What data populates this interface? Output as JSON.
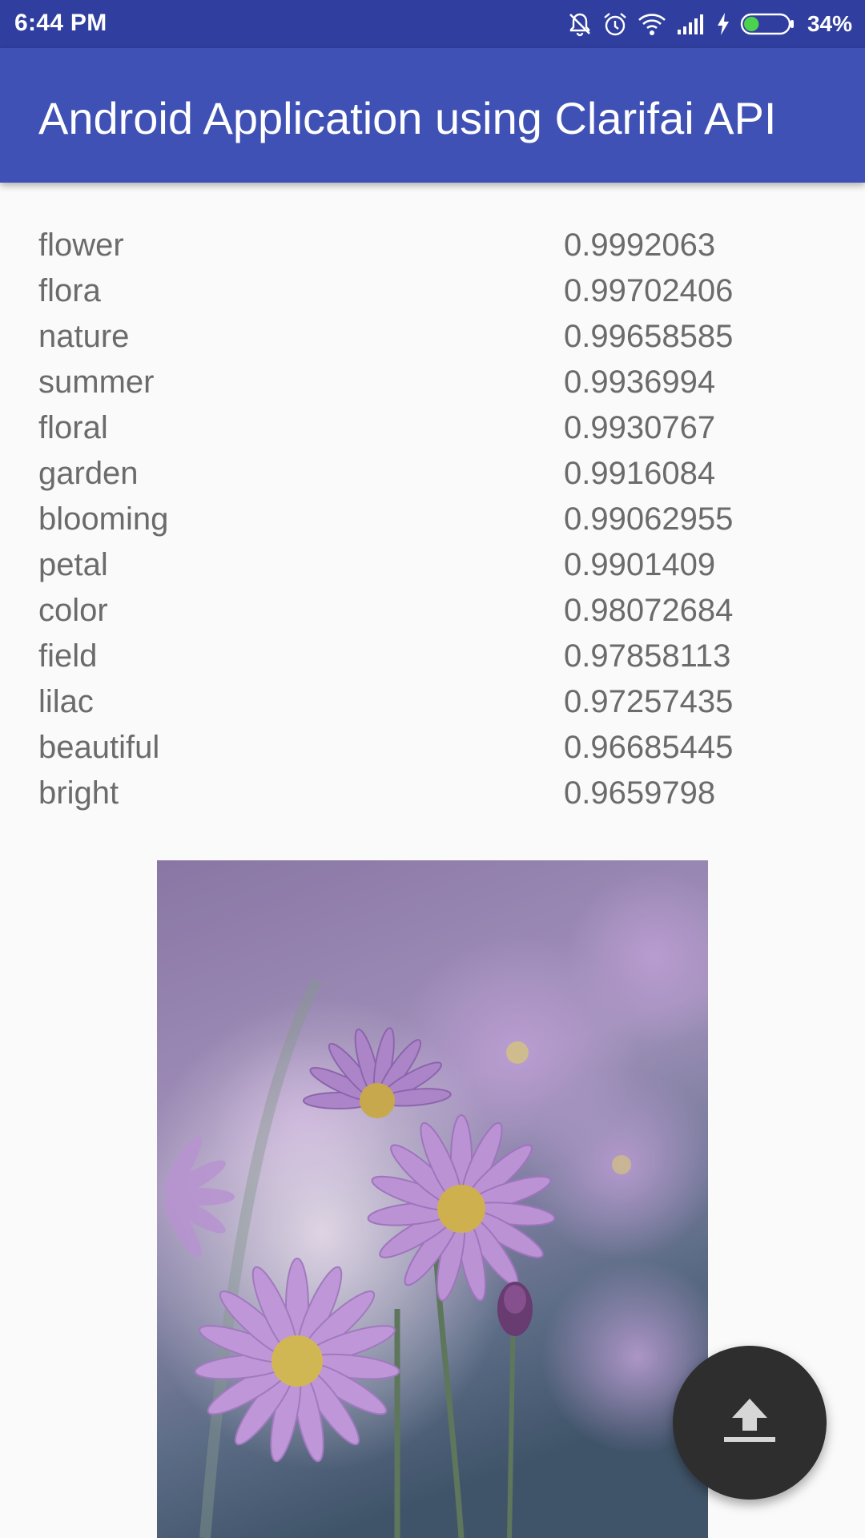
{
  "status_bar": {
    "time": "6:44 PM",
    "battery_percent": "34%",
    "battery_level": 0.34,
    "icons": [
      "mute-icon",
      "alarm-icon",
      "wifi-icon",
      "signal-icon",
      "charging-icon",
      "battery-icon"
    ]
  },
  "app_bar": {
    "title": "Android Application using Clarifai API"
  },
  "tags": [
    {
      "name": "flower",
      "value": "0.9992063"
    },
    {
      "name": "flora",
      "value": "0.99702406"
    },
    {
      "name": "nature",
      "value": "0.99658585"
    },
    {
      "name": "summer",
      "value": "0.9936994"
    },
    {
      "name": "floral",
      "value": "0.9930767"
    },
    {
      "name": "garden",
      "value": "0.9916084"
    },
    {
      "name": "blooming",
      "value": "0.99062955"
    },
    {
      "name": "petal",
      "value": "0.9901409"
    },
    {
      "name": "color",
      "value": "0.98072684"
    },
    {
      "name": "field",
      "value": "0.97858113"
    },
    {
      "name": "lilac",
      "value": "0.97257435"
    },
    {
      "name": "beautiful",
      "value": "0.96685445"
    },
    {
      "name": "bright",
      "value": "0.9659798"
    }
  ],
  "fab": {
    "icon": "upload-icon"
  },
  "colors": {
    "status_bar": "#303f9f",
    "app_bar": "#3f51b5",
    "background": "#fafafa",
    "text": "#6b6b6b",
    "fab": "#2e2e2e"
  }
}
